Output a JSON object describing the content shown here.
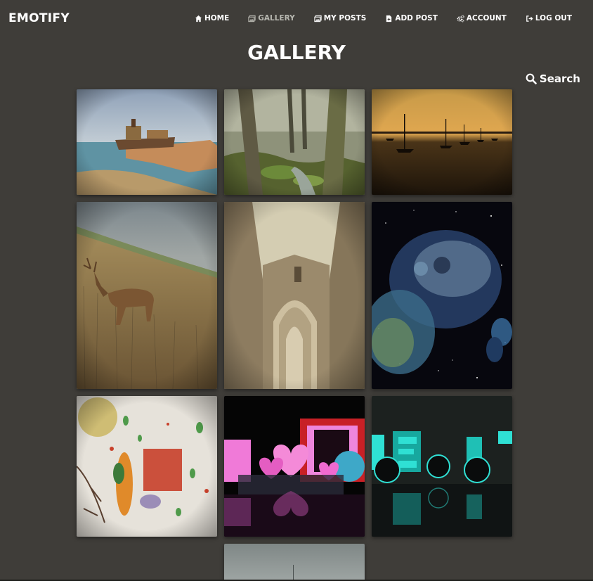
{
  "app": {
    "brand": "EMOTIFY"
  },
  "nav": [
    {
      "label": "HOME",
      "icon": "home-icon",
      "active": false
    },
    {
      "label": "GALLERY",
      "icon": "gallery-icon",
      "active": true
    },
    {
      "label": "MY POSTS",
      "icon": "posts-icon",
      "active": false
    },
    {
      "label": "ADD POST",
      "icon": "add-post-icon",
      "active": false
    },
    {
      "label": "ACCOUNT",
      "icon": "gears-icon",
      "active": false
    },
    {
      "label": "LOG OUT",
      "icon": "logout-icon",
      "active": false
    }
  ],
  "page": {
    "title": "GALLERY"
  },
  "search": {
    "label": "Search",
    "icon": "search-icon"
  },
  "gallery": {
    "images": [
      {
        "subject": "shipwreck on rocky shore",
        "palette": [
          "#a9b8c9",
          "#5a8fa0",
          "#c9a06a"
        ]
      },
      {
        "subject": "mossy forest stream",
        "palette": [
          "#a4a98f",
          "#5d6b3c",
          "#3f4631"
        ]
      },
      {
        "subject": "sailboats at sunset",
        "palette": [
          "#d49a45",
          "#5a3d1c",
          "#231a10"
        ]
      },
      {
        "subject": "deer in golden grass",
        "palette": [
          "#8e9aa0",
          "#a98d5e",
          "#6c5434"
        ]
      },
      {
        "subject": "gothic ruined archway",
        "palette": [
          "#d4cdb2",
          "#8b7a5e",
          "#5e513d"
        ]
      },
      {
        "subject": "astronauts in space bubble",
        "palette": [
          "#06060c",
          "#3d5c8c",
          "#9cc2d9"
        ]
      },
      {
        "subject": "child painting",
        "palette": [
          "#e8e4dd",
          "#c0452d",
          "#4f9a4a"
        ]
      },
      {
        "subject": "pink hearts 3d text",
        "palette": [
          "#0a0a0a",
          "#f26fd4",
          "#c82026"
        ]
      },
      {
        "subject": "neon 3d text",
        "palette": [
          "#1a1f1d",
          "#2fe0d4",
          "#0a0c0c"
        ]
      },
      {
        "subject": "grey sky landscape",
        "palette": [
          "#8a9190",
          "#5f6766",
          "#3f4544"
        ]
      }
    ]
  },
  "colors": {
    "background": "#3f3d39",
    "nav_active": "#b7b7b0",
    "text": "#ffffff"
  }
}
